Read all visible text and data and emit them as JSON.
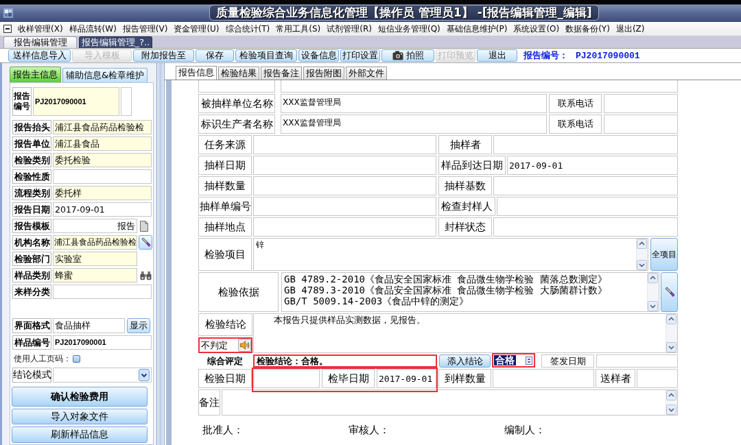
{
  "window": {
    "title": "质量检验综合业务信息化管理【操作员 管理员1】 -[报告编辑管理_编辑]"
  },
  "menu": [
    "收样管理(X)",
    "样品流转(W)",
    "报告管理(V)",
    "资金管理(U)",
    "综合统计(T)",
    "常用工具(S)",
    "试剂管理(R)",
    "短信业务管理(Q)",
    "基础信息维护(P)",
    "系统设置(O)",
    "数据备份(Y)",
    "退出(Z)"
  ],
  "doc_tabs": [
    {
      "label": "报告编辑管理",
      "selected": false
    },
    {
      "label": "报告编辑管理_?..",
      "selected": true
    }
  ],
  "toolbar": {
    "buttons": [
      {
        "label": "送样信息导入",
        "disabled": false,
        "kind": "text"
      },
      {
        "label": "导入模板",
        "disabled": true,
        "kind": "text"
      },
      {
        "label": "附加报告至",
        "disabled": false,
        "kind": "text"
      },
      {
        "label": "保存",
        "disabled": false,
        "kind": "text"
      },
      {
        "label": "检验项目查询",
        "disabled": false,
        "kind": "text"
      },
      {
        "label": "设备信息",
        "disabled": false,
        "kind": "text"
      },
      {
        "label": "打印设置",
        "disabled": false,
        "kind": "text"
      },
      {
        "label": "拍照",
        "disabled": false,
        "kind": "icon"
      },
      {
        "label": "打印预览",
        "disabled": true,
        "kind": "text"
      },
      {
        "label": "退出",
        "disabled": false,
        "kind": "text"
      }
    ],
    "report_no": {
      "label": "报告编号：",
      "value": "PJ2017090001"
    }
  },
  "left_panel": {
    "tabs": [
      {
        "label": "报告主信息",
        "selected": true
      },
      {
        "label": "辅助信息&检章维护",
        "selected": false
      }
    ],
    "fields": [
      {
        "kind": "number",
        "label": "报告编号",
        "value": "PJ2017090001",
        "highlighted": true
      },
      {
        "kind": "text",
        "label": "报告抬头",
        "value": "浦江县食品药品检验检",
        "highlighted": true
      },
      {
        "kind": "text",
        "label": "报告单位",
        "value": "浦江县食品",
        "highlighted": true
      },
      {
        "kind": "text",
        "label": "检验类别",
        "value": "委托检验",
        "highlighted": true
      },
      {
        "kind": "text",
        "label": "检验性质",
        "highlighted": false
      },
      {
        "kind": "text",
        "label": "流程类别",
        "value": "委托样",
        "highlighted": true
      },
      {
        "kind": "text",
        "label": "报告日期",
        "value": "2017-09-01",
        "highlighted": false
      },
      {
        "kind": "template",
        "label": "报告模板",
        "value": "报告",
        "highlighted": false
      },
      {
        "kind": "picker",
        "label": "机构名称",
        "value": "浦江县食品药品检验检",
        "highlighted": true
      },
      {
        "kind": "short",
        "label": "检验部门",
        "value": "实验室",
        "highlighted": true
      },
      {
        "kind": "search",
        "label": "样品类别",
        "value": "蜂蜜",
        "highlighted": true
      },
      {
        "kind": "text",
        "label": "来样分类",
        "highlighted": false
      }
    ],
    "format_fields": [
      {
        "kind": "button",
        "label": "界面格式",
        "value": "食品抽样",
        "button": "显示"
      },
      {
        "kind": "number",
        "label": "样品编号",
        "value": "PJ2017090001"
      }
    ],
    "manual_page_no": {
      "label": "使用人工页码：",
      "checked": false
    },
    "conclusion_mode": {
      "label": "结论模式"
    },
    "buttons": [
      {
        "label": "确认检验费用",
        "kind": "primary"
      },
      {
        "label": "导入对象文件",
        "kind": "normal"
      },
      {
        "label": "刷新样品信息",
        "kind": "normal"
      }
    ]
  },
  "report_form": {
    "tabs": [
      {
        "label": "报告信息",
        "selected": true
      },
      {
        "label": "检验结果",
        "selected": false
      },
      {
        "label": "报告备注",
        "selected": false
      },
      {
        "label": "报告附图",
        "selected": false
      },
      {
        "label": "外部文件",
        "selected": false
      }
    ],
    "rows": [
      {
        "kind": "wide",
        "label": "被抽样单位名称",
        "value": "XXX监督管理局",
        "side_label": "联系电话"
      },
      {
        "kind": "wide",
        "label": "标识生产者名称",
        "value": "XXX监督管理局",
        "side_label": "联系电话"
      },
      {
        "kind": "pair",
        "label": "任务来源",
        "side_label": "抽样者"
      },
      {
        "kind": "pair",
        "label": "抽样日期",
        "side_label": "样品到达日期",
        "side_value": "2017-09-01"
      },
      {
        "kind": "pair",
        "label": "抽样数量",
        "side_label": "抽样基数"
      },
      {
        "kind": "pair",
        "label": "抽样单编号",
        "side_label": "检查封样人"
      },
      {
        "kind": "pair",
        "label": "抽样地点",
        "side_label": "封样状态"
      },
      {
        "kind": "items",
        "label": "检验项目",
        "lines": [
          "锌"
        ],
        "button": "全项目"
      },
      {
        "kind": "basis",
        "label": "检验依据",
        "lines": [
          "GB 4789.2-2010《食品安全国家标准 食品微生物学检验 菌落总数测定》",
          "GB 4789.3-2010《食品安全国家标准 食品微生物学检验 大肠菌群计数》",
          "GB/T 5009.14-2003《食品中锌的测定》"
        ]
      },
      {
        "kind": "conclusion",
        "label": "检验结论",
        "text": "本报告只提供样品实测数据，见报告。",
        "verdict": {
          "value": "不判定",
          "outlined": true
        }
      },
      {
        "kind": "evaluation",
        "label": "综合评定",
        "value": "检验结论：合格。",
        "outlined": true,
        "button": "添入结论",
        "select": {
          "value": "合格",
          "highlighted": true,
          "outlined": true
        },
        "side_label": "签发日期"
      },
      {
        "kind": "dates",
        "label": "检验日期",
        "outlined": true,
        "mid_label": "检毕日期",
        "mid_value": "2017-09-01",
        "side_label": "到样数量",
        "end_label": "送样者"
      },
      {
        "kind": "notes",
        "label": "备注"
      }
    ],
    "signatures": [
      "批准人：",
      "审核人：",
      "编制人："
    ]
  }
}
